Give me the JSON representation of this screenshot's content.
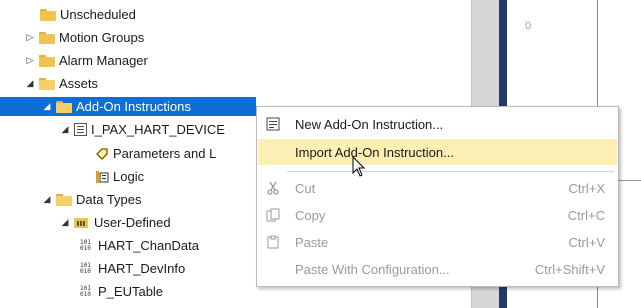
{
  "tree": {
    "items": [
      {
        "label": "Unscheduled",
        "icon": "folder-icon",
        "expanded": null
      },
      {
        "label": "Motion Groups",
        "icon": "folder-icon",
        "expanded": false
      },
      {
        "label": "Alarm Manager",
        "icon": "folder-icon",
        "expanded": false
      },
      {
        "label": "Assets",
        "icon": "open-folder-icon",
        "expanded": true
      },
      {
        "label": "Add-On Instructions",
        "icon": "open-folder-icon",
        "expanded": true,
        "selected": true
      },
      {
        "label": "I_PAX_HART_DEVICE",
        "icon": "aoi-icon",
        "expanded": true
      },
      {
        "label": "Parameters and L",
        "icon": "parameters-icon"
      },
      {
        "label": "Logic",
        "icon": "logic-icon"
      },
      {
        "label": "Data Types",
        "icon": "open-folder-icon",
        "expanded": true
      },
      {
        "label": "User-Defined",
        "icon": "udt-icon",
        "expanded": true
      },
      {
        "label": "HART_ChanData",
        "icon": "binary-icon"
      },
      {
        "label": "HART_DevInfo",
        "icon": "binary-icon"
      },
      {
        "label": "P_EUTable",
        "icon": "binary-icon"
      }
    ]
  },
  "ladder": {
    "rung_number": "0"
  },
  "context_menu": {
    "items": [
      {
        "label": "New Add-On Instruction...",
        "shortcut": "",
        "icon": "new-aoi-icon",
        "enabled": true
      },
      {
        "label": "Import Add-On Instruction...",
        "shortcut": "",
        "icon": "",
        "enabled": true,
        "hovered": true
      },
      {
        "label": "Cut",
        "shortcut": "Ctrl+X",
        "icon": "scissors-icon",
        "enabled": false
      },
      {
        "label": "Copy",
        "shortcut": "Ctrl+C",
        "icon": "copy-icon",
        "enabled": false
      },
      {
        "label": "Paste",
        "shortcut": "Ctrl+V",
        "icon": "paste-icon",
        "enabled": false
      },
      {
        "label": "Paste With Configuration...",
        "shortcut": "Ctrl+Shift+V",
        "icon": "",
        "enabled": false
      }
    ]
  },
  "colors": {
    "selection": "#0d6fd6",
    "menu_hover": "#fbefb4",
    "divider": "#1f3b66",
    "folder": "#f0c350"
  }
}
